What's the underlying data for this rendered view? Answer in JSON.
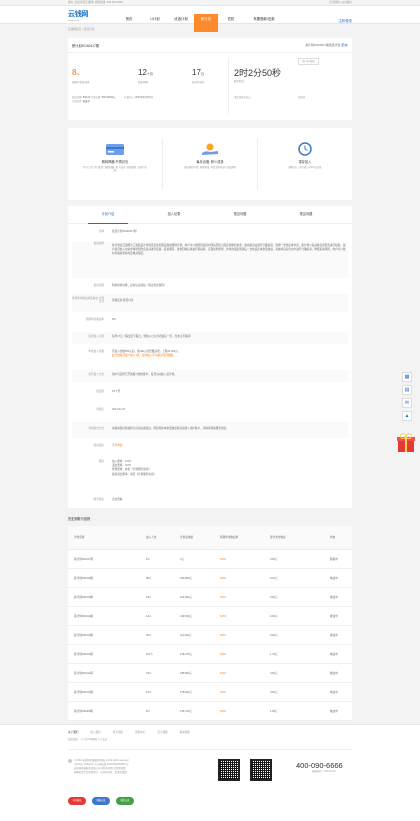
{
  "topbar": {
    "left": "你好, 欢迎来到云钱网 | 客服热线: 400-090-6666",
    "right": "官方微博 | 关注微信"
  },
  "brand": {
    "name": "云钱网",
    "sub": "yunqian.com"
  },
  "nav": {
    "items": [
      "首页",
      "U计划",
      "优选计划",
      "薪计划",
      "债权",
      "有要借款/还款"
    ],
    "active_index": 3,
    "login": "注册",
    "login_sep": "/",
    "register": "登录"
  },
  "breadcrumb": "云钱网首页 > 优选计划",
  "plan": {
    "name": "薪计划20160417期",
    "tag_label": "薪计划20160417期优选计划",
    "tag_link": "[",
    "tag_link2": "范本",
    "tag_close": "]",
    "rate": "8",
    "rate_unit": "%",
    "rate_label": "预期年化收益率",
    "term": "12",
    "term_unit": "个月",
    "term_label": "锁定期限",
    "day": "17",
    "day_unit": "日",
    "day_label": "每月付款日",
    "min_label": "起投金额:",
    "min_value": "500.00",
    "total_label": "计划总额:",
    "total_value": "500,00000元",
    "status_label": "计划状态:",
    "status_value": "募集中",
    "start_label": "开始加入:",
    "start_value": "2017年04月17日",
    "countdown": "2时2分50秒",
    "countdown_label": "剩余时间",
    "user_label": "用户名/密码",
    "button": "立即加入",
    "note1": "请先登录后加入",
    "note2": "请登录"
  },
  "features": [
    {
      "icon": "card-icon",
      "title": "薪转神器 不再月光",
      "desc": "月付工资, 月月投资, 强制储蓄, 积少成多, 轻松理财, 告别月光族"
    },
    {
      "icon": "coin-hand-icon",
      "title": "每月出借, 积少成多",
      "desc": "养成理财习惯, 积累财富, 享受复利收益, 轻松理财"
    },
    {
      "icon": "clock-icon",
      "title": "零存加入",
      "desc": "随时加入, 零门槛, 从500元起投"
    }
  ],
  "tabs": [
    "计划介绍",
    "加入记录",
    "常见问题",
    "常见问题"
  ],
  "details": [
    {
      "k": "名称",
      "v": "优选计划20160417期"
    },
    {
      "k": "投资说明",
      "v": "薪计划是云钱网为工薪族设计的每月定投的固定收益理财计划，用户可以按照约定的时间每月投入固定金额的资金，由系统自动进行分散投资，到期一次性还本付息。薪计划以自动投标的形式进行投资，用户每月加入的资金将按照约定自动进行投资。投资期间，资金回收后将进行再投资，实现复利增值，并将在锁定期满后一次性返还本金及收益。系统将自动为用户进行分散投资，降低投资风险，用户可以随时查看资金投向及收益情况。"
    },
    {
      "k": "投资范围",
      "v": "利用债转功能，定向认证债权（保证金担保等）"
    },
    {
      "k": "预期年化收益率及收益 计算方式",
      "v": "到期还款 按月付息"
    },
    {
      "k": "预期年化收益率",
      "v": "8%"
    },
    {
      "k": "每月加入日期",
      "v": "每月17日（遇法定节假日，则加入日为当月最后一天，月末日不顺延）"
    },
    {
      "k": "单次加入金额",
      "v": "月加入金额500元起，按100元的倍数递增，上限20,000元。",
      "v2": "此计划每月最少加入1次，每次加入不可超过当月限额。"
    },
    {
      "k": "每月加入方式",
      "v": "用户可选择已开通薪计划的账户，每月自动加入该计划。"
    },
    {
      "k": "锁定期",
      "v": "12个月"
    },
    {
      "k": "到期日",
      "v": "2017-04-17"
    },
    {
      "k": "到期退出方式",
      "v": "系统将通过债权转让自动完成退出，所获得的本金及收益将自动转入用户账户，详情请查看服务协议。"
    },
    {
      "k": "提前退出",
      "v": "不可申请",
      "orange": true
    },
    {
      "k": "费用",
      "v": "加入费率：0.0%",
      "v3": "退出费率：0.0%",
      "v4": "管理费率：参见《计划服务协议》",
      "v5": "提前退出费率：参见《计划服务协议》"
    },
    {
      "k": "服务协议",
      "v": "点击查看",
      "blue": true
    }
  ],
  "history": {
    "title": "历史期数与回报",
    "headers": [
      "计划名称",
      "加入人次",
      "计划总金额",
      "预期年化收益率",
      "累计支付收益",
      "状态"
    ],
    "rows": [
      [
        "薪计划160417期",
        "6人",
        "0元",
        "8.0%",
        "0.00元",
        "募集中"
      ],
      [
        "薪计划160416期",
        "96人",
        "199,800元",
        "8.0%",
        "0.01元",
        "收益中"
      ],
      [
        "薪计划160415期",
        "63人",
        "103,500元",
        "8.0%",
        "0.00元",
        "收益中"
      ],
      [
        "薪计划160414期",
        "14人",
        "139,500元",
        "8.0%",
        "0.00元",
        "收益中"
      ],
      [
        "薪计划160413期",
        "45人",
        "111,600元",
        "8.0%",
        "0.00元",
        "收益中"
      ],
      [
        "薪计划160412期",
        "101人",
        "148,700元",
        "8.0%",
        "1.78元",
        "收益中"
      ],
      [
        "薪计划160411期",
        "79人",
        "185,800元",
        "8.0%",
        "0.00元",
        "收益中"
      ],
      [
        "薪计划160410期",
        "61人",
        "175,600元",
        "8.0%",
        "0.00元",
        "收益中"
      ],
      [
        "薪计划160409期",
        "8人",
        "145,700元",
        "8.0%",
        "1.95元",
        "收益中"
      ]
    ]
  },
  "footer": {
    "links": [
      "关于我们",
      "加入我们",
      "新手指南",
      "帮助中心",
      "安全保障",
      "联系我们"
    ],
    "links2": "友情链接：  人人贷     WE理财     人人友信",
    "copy1": "© 2016 云钱网金融服务有限公司 All rights reserved",
    "copy2": "京ICP证 160513号 京公网安备 11010502032015 号",
    "copy3": "云钱网金融服务有限公司  网贷有风险 出借需谨慎",
    "copy4": "网络投资平台风险提示：市场有风险，投资需谨慎",
    "phone": "400-090-6666",
    "hours": "客服时间：9:00-21:00",
    "badges": [
      "可信网站",
      "网络认证",
      "网信认证"
    ]
  },
  "colors": {
    "accent": "#ff8a2b",
    "orange": "#ff6c00",
    "blue": "#1b6fc9"
  }
}
